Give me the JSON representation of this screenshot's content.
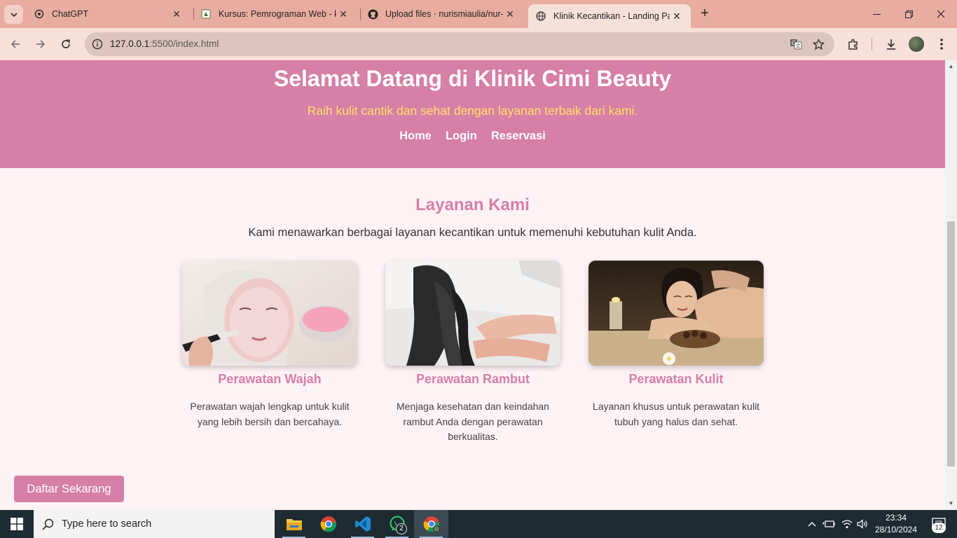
{
  "browser": {
    "tabs": [
      {
        "title": "ChatGPT",
        "icon": "chatgpt-icon"
      },
      {
        "title": "Kursus: Pemrograman Web - ke",
        "icon": "course-icon"
      },
      {
        "title": "Upload files · nurismiaulia/nur-i",
        "icon": "github-icon"
      },
      {
        "title": "Klinik Kecantikan - Landing Pag",
        "icon": "globe-icon",
        "active": true
      }
    ],
    "url_host": "127.0.0.1",
    "url_path": ":5500/index.html"
  },
  "page": {
    "hero": {
      "title": "Selamat Datang di Klinik Cimi Beauty",
      "tagline": "Raih kulit cantik dan sehat dengan layanan terbaik dari kami.",
      "nav": [
        "Home",
        "Login",
        "Reservasi"
      ]
    },
    "services": {
      "title": "Layanan Kami",
      "description": "Kami menawarkan berbagai layanan kecantikan untuk memenuhi kebutuhan kulit Anda.",
      "items": [
        {
          "name": "Perawatan Wajah",
          "description": "Perawatan wajah lengkap untuk kulit yang lebih bersih dan bercahaya."
        },
        {
          "name": "Perawatan Rambut",
          "description": "Menjaga kesehatan dan keindahan rambut Anda dengan perawatan berkualitas."
        },
        {
          "name": "Perawatan Kulit",
          "description": "Layanan khusus untuk perawatan kulit tubuh yang halus dan sehat."
        }
      ]
    },
    "cta_label": "Daftar Sekarang"
  },
  "taskbar": {
    "search_placeholder": "Type here to search",
    "whatsapp_badge": "2",
    "time": "23:34",
    "date": "28/10/2024",
    "notifications": "12"
  },
  "colors": {
    "brand_pink": "#d67fa7",
    "tagline_yellow": "#ffe066",
    "page_bg": "#fdf2f4"
  }
}
